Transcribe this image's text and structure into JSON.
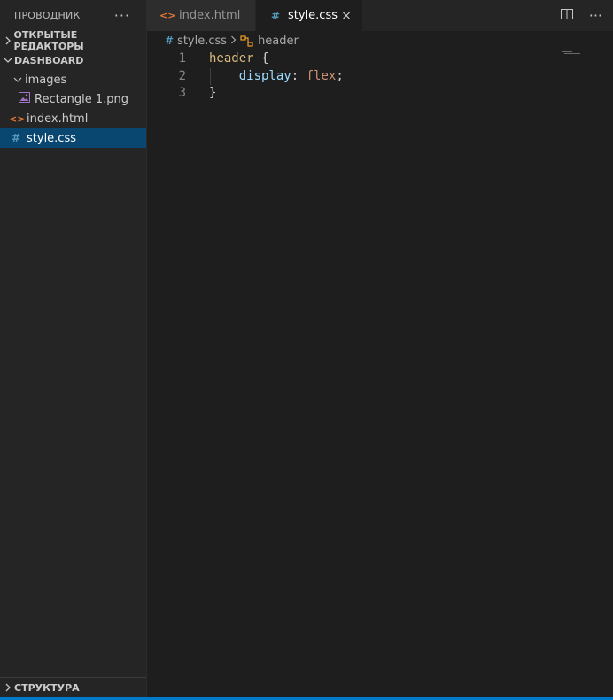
{
  "sidebar": {
    "title": "ПРОВОДНИК",
    "more_icon": "ellipsis-icon",
    "open_editors": {
      "label": "ОТКРЫТЫЕ РЕДАКТОРЫ",
      "expanded": false
    },
    "project": {
      "label": "DASHBOARD",
      "expanded": true
    },
    "tree": {
      "folder_images": "images",
      "file_rectangle": "Rectangle 1.png",
      "file_index": "index.html",
      "file_style": "style.css"
    },
    "outline": {
      "label": "СТРУКТУРА",
      "expanded": false
    }
  },
  "tabs": [
    {
      "label": "index.html",
      "icon": "html-file-icon",
      "active": false
    },
    {
      "label": "style.css",
      "icon": "css-file-icon",
      "active": true,
      "close": "×"
    }
  ],
  "tab_actions": {
    "split_icon": "split-editor-icon",
    "more_icon": "ellipsis-icon"
  },
  "breadcrumb": {
    "file": "style.css",
    "symbol": "header"
  },
  "editor": {
    "lines": [
      {
        "num": "1",
        "selector": "header",
        "brace": " {"
      },
      {
        "num": "2",
        "property": "display",
        "colon": ": ",
        "value": "flex",
        "semi": ";"
      },
      {
        "num": "3",
        "brace": "}"
      }
    ]
  },
  "colors": {
    "accent": "#007acc",
    "selected_item": "#094771",
    "html_icon": "#e37933",
    "css_icon": "#519aba",
    "selector": "#d7ba7d",
    "property": "#9cdcfe",
    "value": "#ce9178"
  }
}
